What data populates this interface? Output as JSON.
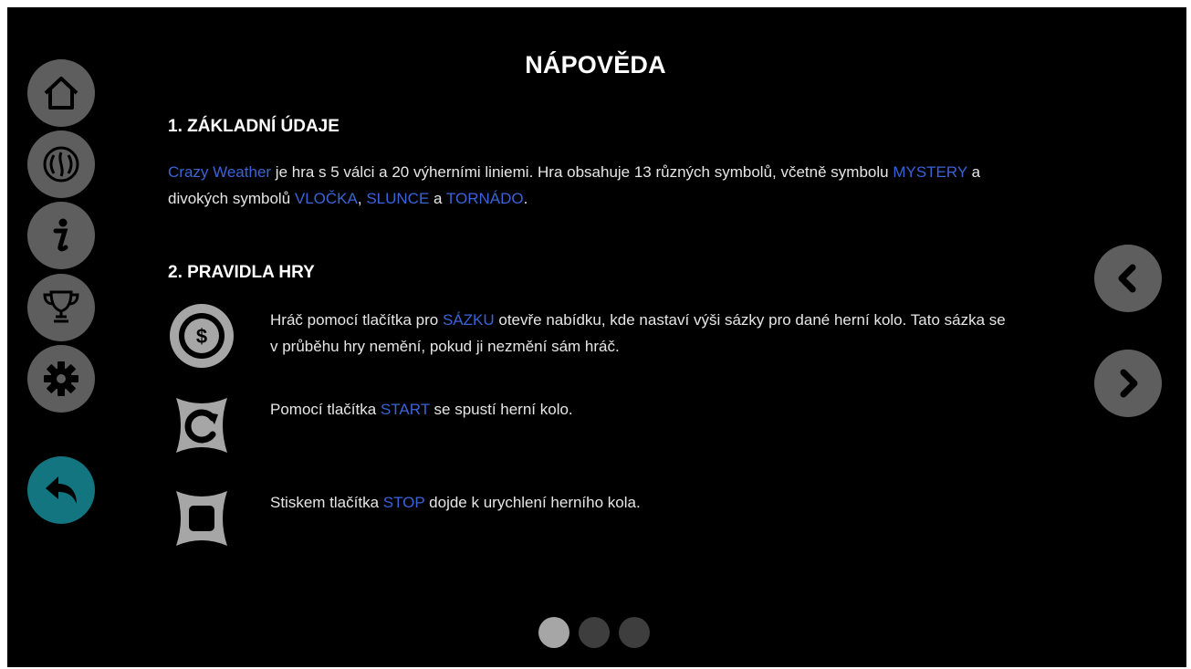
{
  "title": "NÁPOVĚDA",
  "sidebar": [
    {
      "name": "home-icon"
    },
    {
      "name": "reels-icon"
    },
    {
      "name": "info-icon"
    },
    {
      "name": "trophy-icon"
    },
    {
      "name": "gear-icon"
    },
    {
      "name": "back-arrow-icon"
    }
  ],
  "colors": {
    "highlight": "#3b63d8",
    "accent": "#127580",
    "button": "#5e5e5e"
  },
  "section1": {
    "heading": "1. ZÁKLADNÍ ÚDAJE",
    "game_name": "Crazy Weather",
    "t1": " je hra s 5 válci a 20 výherními liniemi. Hra obsahuje 13 různých symbolů, včetně symbolu ",
    "mystery": "MYSTERY",
    "t2": " a",
    "t3": "divokých symbolů ",
    "vlocka": "VLOČKA",
    "t4": ", ",
    "slunce": "SLUNCE",
    "t5": " a ",
    "tornado": "TORNÁDO",
    "t6": "."
  },
  "section2": {
    "heading": "2. PRAVIDLA HRY",
    "rule1": {
      "icon": "coin-icon",
      "t1": "Hráč pomocí tlačítka pro ",
      "hl": "SÁZKU",
      "t2": " otevře nabídku, kde nastaví výši sázky pro dané herní kolo. Tato sázka se",
      "t3": "v průběhu hry nemění, pokud ji nezmění sám hráč."
    },
    "rule2": {
      "icon": "spin-icon",
      "t1": "Pomocí tlačítka ",
      "hl": "START",
      "t2": " se spustí herní kolo."
    },
    "rule3": {
      "icon": "stop-icon",
      "t1": "Stiskem tlačítka ",
      "hl": "STOP",
      "t2": " dojde k urychlení herního kola."
    }
  },
  "nav": {
    "prev_icon": "chevron-left-icon",
    "next_icon": "chevron-right-icon"
  },
  "pager": {
    "pages": 3,
    "active": 1
  }
}
